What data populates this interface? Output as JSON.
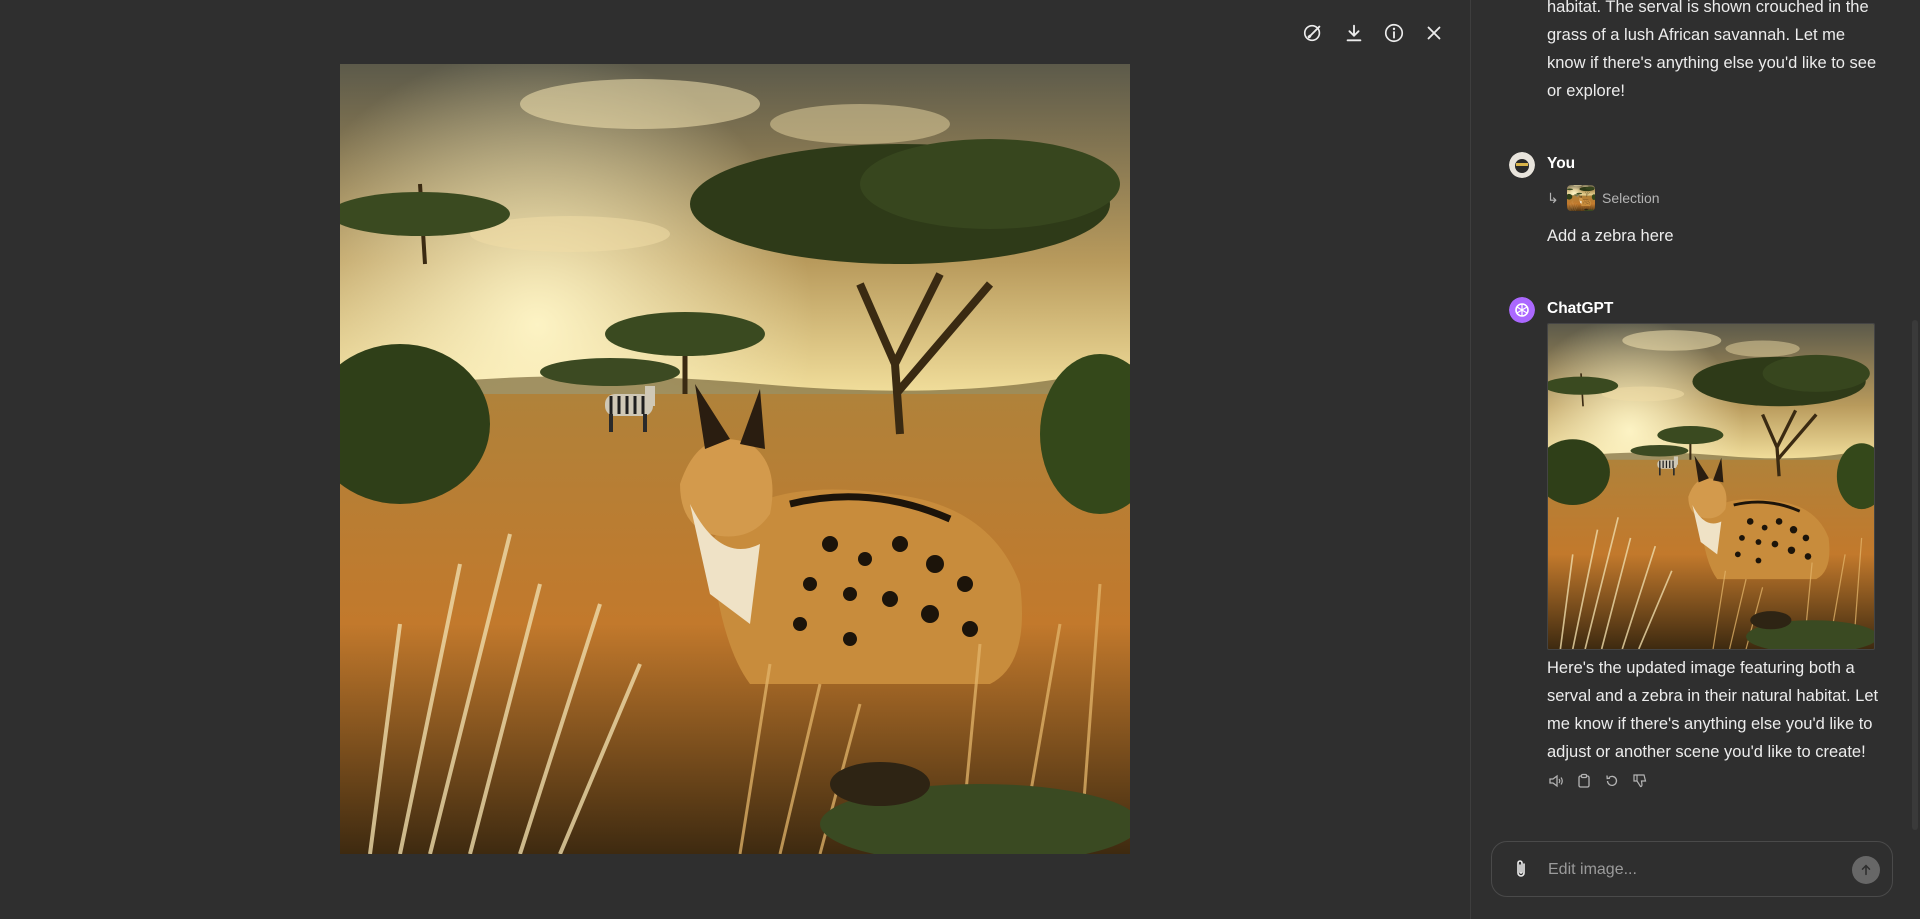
{
  "viewer": {
    "toolbar": {
      "select_icon": "brush-select-icon",
      "download_icon": "download-icon",
      "info_icon": "info-icon",
      "close_icon": "close-icon"
    }
  },
  "chat": {
    "prev_message_tail": "habitat. The serval is shown crouched in the grass of a lush African savannah. Let me know if there's anything else you'd like to see or explore!",
    "user": {
      "name": "You",
      "selection_label": "Selection",
      "message": "Add a zebra here"
    },
    "assistant": {
      "name": "ChatGPT",
      "message": "Here's the updated image featuring both a serval and a zebra in their natural habitat. Let me know if there's anything else you'd like to adjust or another scene you'd like to create!"
    },
    "actions": [
      "speaker-icon",
      "copy-icon",
      "regenerate-icon",
      "thumbs-down-icon"
    ]
  },
  "composer": {
    "placeholder": "Edit image...",
    "value": ""
  },
  "colors": {
    "background": "#2f2f2f",
    "text": "#ececec",
    "assistant_avatar": "#ab68ff"
  }
}
